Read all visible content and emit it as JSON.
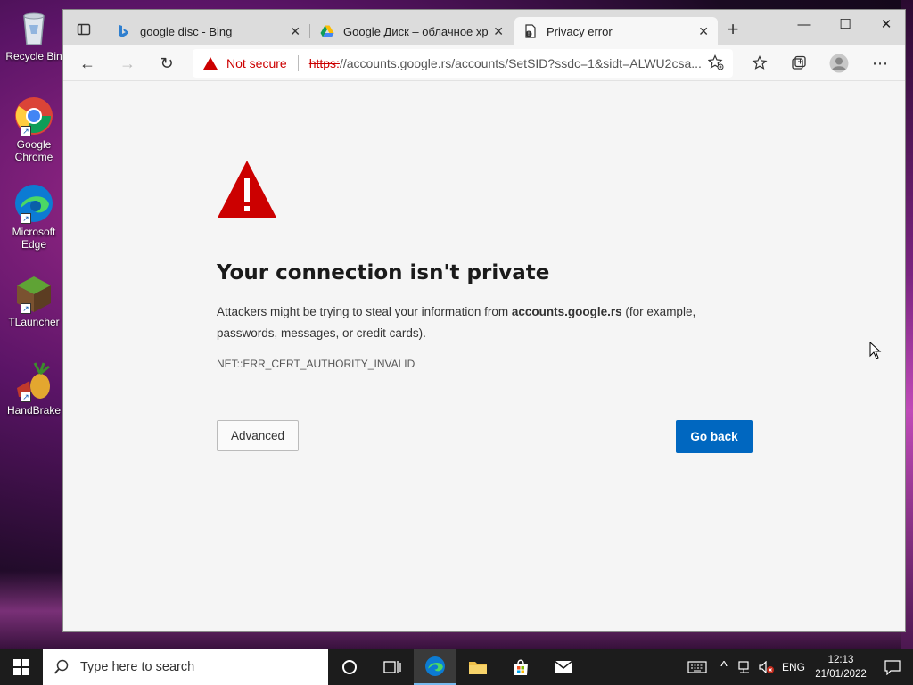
{
  "desktop": {
    "icons": [
      {
        "label": "Recycle Bin"
      },
      {
        "label": "Google Chrome"
      },
      {
        "label": "Microsoft Edge"
      },
      {
        "label": "TLauncher"
      },
      {
        "label": "HandBrake"
      }
    ]
  },
  "browser": {
    "tabs": [
      {
        "title": "google disc - Bing"
      },
      {
        "title": "Google Диск – облачное хранилище"
      },
      {
        "title": "Privacy error"
      }
    ],
    "security_label": "Not secure",
    "url_scheme": "https:",
    "url_rest": "//accounts.google.rs/accounts/SetSID?ssdc=1&sidt=ALWU2csa...",
    "page": {
      "heading": "Your connection isn't private",
      "para_before": "Attackers might be trying to steal your information from ",
      "para_domain": "accounts.google.rs",
      "para_after": " (for example, passwords, messages, or credit cards).",
      "error_code": "NET::ERR_CERT_AUTHORITY_INVALID",
      "advanced_label": "Advanced",
      "go_back_label": "Go back"
    }
  },
  "taskbar": {
    "search_placeholder": "Type here to search",
    "language": "ENG",
    "time": "12:13",
    "date": "21/01/2022"
  },
  "colors": {
    "accent": "#0067c0",
    "warning": "#cc0000"
  }
}
